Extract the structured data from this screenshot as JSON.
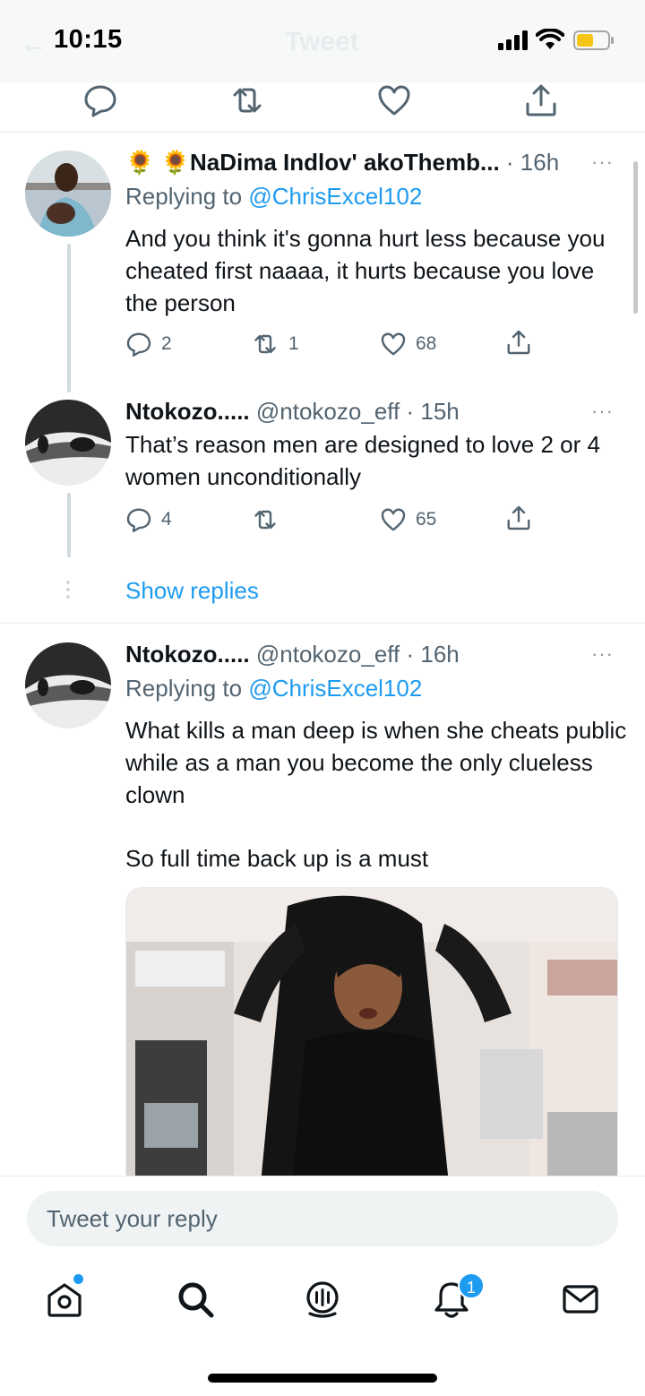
{
  "status_bar": {
    "time": "10:15",
    "ghost_title": "Tweet",
    "ghost_back": "←"
  },
  "tweets": [
    {
      "name": "🌻 🌻NaDima Indlov' akoThemb...",
      "meta": " · 16h",
      "replying_label": "Replying to ",
      "replying_handle": "@ChrisExcel102",
      "text": "And you think it's gonna hurt less because you cheated first naaaa,  it hurts because you love the person",
      "replies": "2",
      "retweets": "1",
      "likes": "68"
    },
    {
      "name": "Ntokozo.....",
      "meta": " @ntokozo_eff · 15h",
      "text": "That’s reason men are designed to love 2 or 4 women unconditionally",
      "replies": "4",
      "retweets": "",
      "likes": "65"
    },
    {
      "name": "Ntokozo.....",
      "meta": " @ntokozo_eff · 16h",
      "replying_label": "Replying to ",
      "replying_handle": "@ChrisExcel102",
      "text": "What kills a man deep is when she cheats public while as a man you become the only clueless clown",
      "text2": "So full time back up is a must"
    }
  ],
  "show_replies": "Show replies",
  "more_glyph": "···",
  "reply_bar": {
    "placeholder": "Tweet your reply"
  },
  "tabbar": {
    "notification_count": "1"
  },
  "colors": {
    "accent": "#1d9bf0",
    "text": "#0f1419",
    "muted": "#536471",
    "divider": "#e6ecf0"
  },
  "icons": [
    "reply-icon",
    "retweet-icon",
    "like-icon",
    "share-icon",
    "home-icon",
    "search-icon",
    "spaces-icon",
    "notifications-icon",
    "messages-icon"
  ]
}
